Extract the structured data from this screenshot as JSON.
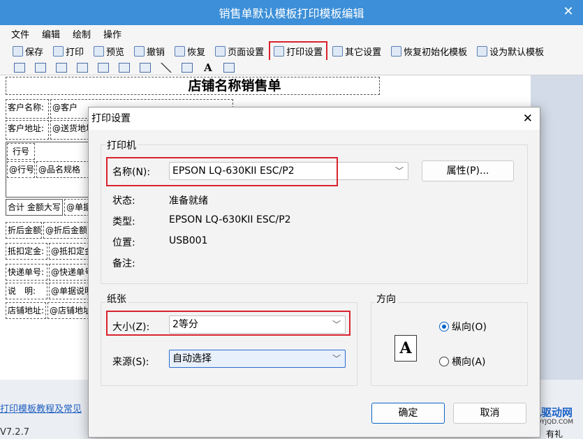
{
  "window": {
    "title": "销售单默认模板打印模板编辑",
    "close_glyph": "✕"
  },
  "menu": [
    "文件",
    "编辑",
    "绘制",
    "操作"
  ],
  "toolbar": [
    {
      "label": "保存",
      "icon": "save-icon"
    },
    {
      "label": "打印",
      "icon": "printer-icon"
    },
    {
      "label": "预览",
      "icon": "preview-icon"
    },
    {
      "label": "撤销",
      "icon": "undo-icon"
    },
    {
      "label": "恢复",
      "icon": "redo-icon"
    },
    {
      "label": "页面设置",
      "icon": "page-setup-icon"
    },
    {
      "label": "打印设置",
      "icon": "print-settings-icon"
    },
    {
      "label": "其它设置",
      "icon": "gear-icon"
    },
    {
      "label": "恢复初始化模板",
      "icon": "restore-icon"
    },
    {
      "label": "设为默认模板",
      "icon": "default-template-icon"
    }
  ],
  "template": {
    "title": "店铺名称销售单",
    "fields": {
      "customer_name_label": "客户名称:",
      "customer_name_value": "@客户",
      "customer_addr_label": "客户地址:",
      "customer_addr_value": "@送货地址",
      "row_no_header": "行号",
      "row_no_value": "@行号",
      "product_value": "@品名规格",
      "total_label": "合计 金额大写",
      "total_value": "@单据",
      "discount_label": "折后金额",
      "discount_value": "@折后金额",
      "deposit_label": "抵扣定金:",
      "deposit_value": "@抵扣定金",
      "express_label": "快递单号:",
      "express_value": "@快递单号",
      "note_label": "说　明:",
      "note_value": "@单据说明",
      "shop_addr_label": "店铺地址:",
      "shop_addr_value": "@店铺地址"
    }
  },
  "footer": {
    "link": "打印模板教程及常见",
    "version": "V7.2.7",
    "watermark": "打印机驱动网",
    "watermark_url": "WWW.DYJQD.COM",
    "side_text": "有礼"
  },
  "dialog": {
    "title": "打印设置",
    "printer_group": "打印机",
    "name_label": "名称(N):",
    "printer_name": "EPSON LQ-630KII ESC/P2",
    "properties_button": "属性(P)...",
    "status_label": "状态:",
    "status_value": "准备就绪",
    "type_label": "类型:",
    "type_value": "EPSON LQ-630KII ESC/P2",
    "location_label": "位置:",
    "location_value": "USB001",
    "comment_label": "备注:",
    "comment_value": "",
    "paper_group": "纸张",
    "size_label": "大小(Z):",
    "size_value": "2等分",
    "source_label": "来源(S):",
    "source_value": "自动选择",
    "orientation_group": "方向",
    "portrait_label": "纵向(O)",
    "landscape_label": "横向(A)",
    "orientation_selected": "portrait",
    "ok_button": "确定",
    "cancel_button": "取消"
  },
  "colors": {
    "titlebar": "#3c8fd8",
    "highlight_red": "#d9232e",
    "accent_blue": "#0a64c8"
  }
}
